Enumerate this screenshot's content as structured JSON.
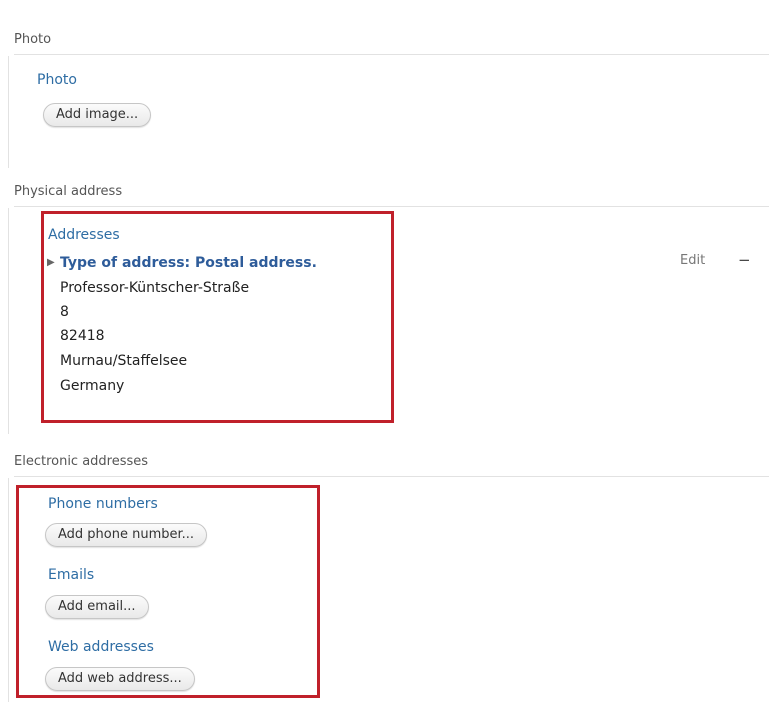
{
  "photo_section": {
    "header": "Photo",
    "field_label": "Photo",
    "add_button": "Add image..."
  },
  "physical_section": {
    "header": "Physical address",
    "field_label": "Addresses",
    "address_type": "Type of address: Postal address.",
    "lines": [
      "Professor-Küntscher-Straße",
      "8",
      "82418",
      "Murnau/Staffelsee",
      "Germany"
    ],
    "edit_label": "Edit",
    "remove_glyph": "−"
  },
  "electronic_section": {
    "header": "Electronic addresses",
    "phone_label": "Phone numbers",
    "phone_button": "Add phone number...",
    "email_label": "Emails",
    "email_button": "Add email...",
    "web_label": "Web addresses",
    "web_button": "Add web address..."
  },
  "colors": {
    "link_blue": "#2e6da4",
    "highlight_red": "#c0202a"
  }
}
